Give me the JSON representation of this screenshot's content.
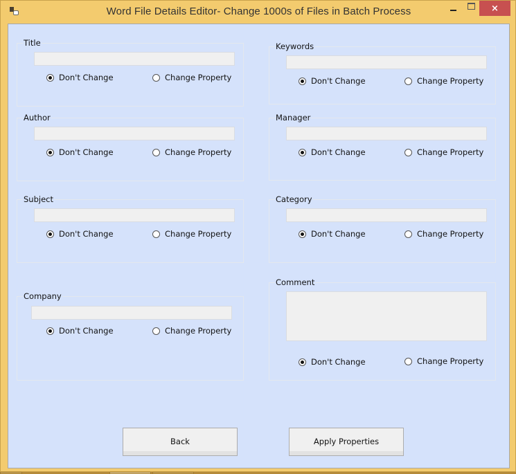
{
  "window": {
    "title": "Word File Details Editor- Change 1000s of Files in Batch Process",
    "controls": {
      "minimize": "minimize",
      "maximize": "maximize",
      "close": "×"
    },
    "accent_colors": {
      "frame": "#f3cb6e",
      "client": "#d5e2fb",
      "close": "#c75050"
    }
  },
  "radio_labels": {
    "keep": "Don't Change",
    "change": "Change Property"
  },
  "groups": [
    {
      "id": "title",
      "label": "Title",
      "value": "",
      "selected": "keep"
    },
    {
      "id": "author",
      "label": "Author",
      "value": "",
      "selected": "keep"
    },
    {
      "id": "subject",
      "label": "Subject",
      "value": "",
      "selected": "keep"
    },
    {
      "id": "company",
      "label": "Company",
      "value": "",
      "selected": "keep"
    },
    {
      "id": "keywords",
      "label": "Keywords",
      "value": "",
      "selected": "keep"
    },
    {
      "id": "manager",
      "label": "Manager",
      "value": "",
      "selected": "keep"
    },
    {
      "id": "category",
      "label": "Category",
      "value": "",
      "selected": "keep"
    },
    {
      "id": "comment",
      "label": "Comment",
      "value": "",
      "selected": "keep"
    }
  ],
  "buttons": {
    "back": "Back",
    "apply": "Apply Properties"
  }
}
